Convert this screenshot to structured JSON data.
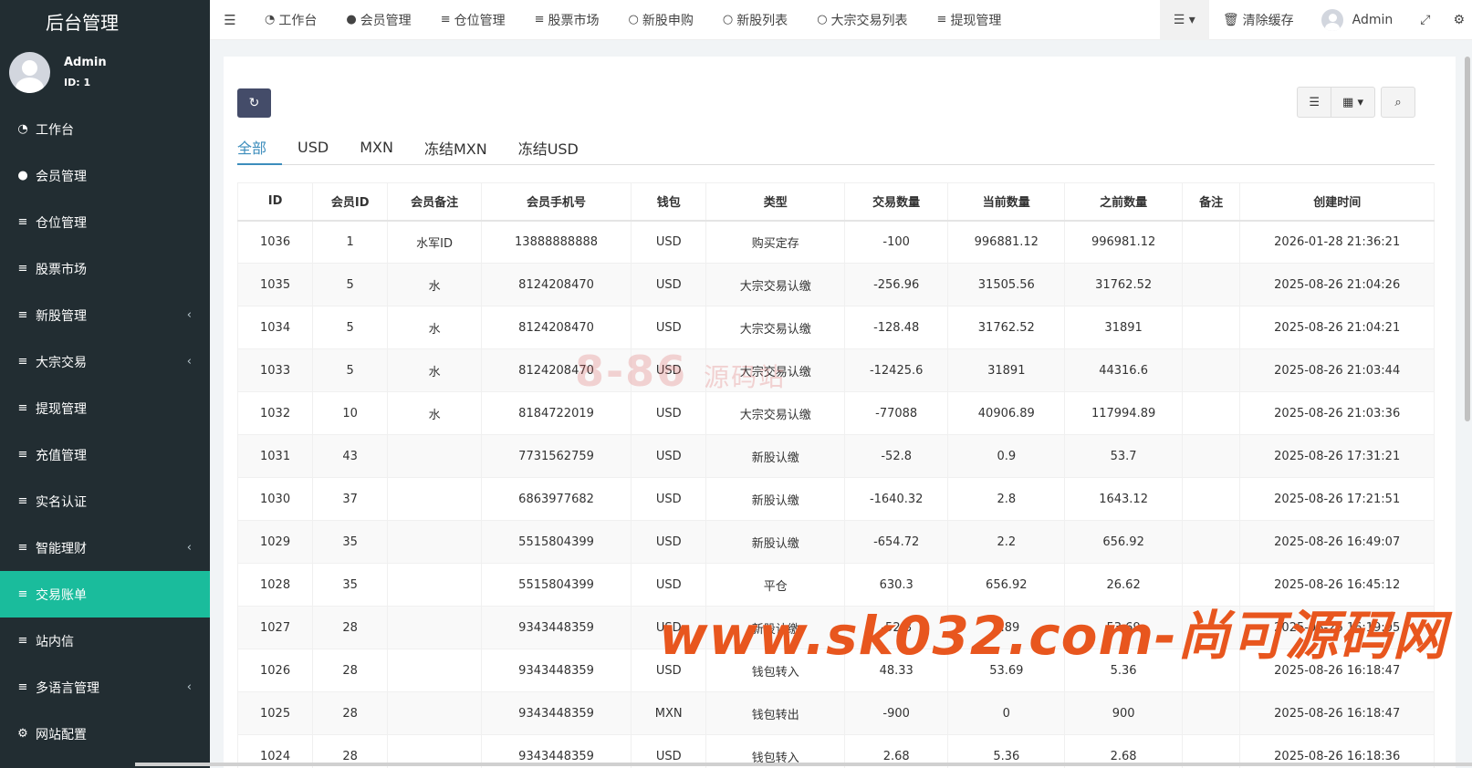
{
  "brand": "后台管理",
  "user": {
    "name": "Admin",
    "id": "ID: 1"
  },
  "sidebar": {
    "items": [
      {
        "label": "工作台",
        "icon": "dashboard-icon",
        "glyph": "◔",
        "arrow": false
      },
      {
        "label": "会员管理",
        "icon": "user-circle-icon",
        "glyph": "●",
        "arrow": false
      },
      {
        "label": "仓位管理",
        "icon": "bars-icon",
        "glyph": "≡",
        "arrow": false
      },
      {
        "label": "股票市场",
        "icon": "bars-icon",
        "glyph": "≡",
        "arrow": false
      },
      {
        "label": "新股管理",
        "icon": "bars-icon",
        "glyph": "≡",
        "arrow": true
      },
      {
        "label": "大宗交易",
        "icon": "bars-icon",
        "glyph": "≡",
        "arrow": true
      },
      {
        "label": "提现管理",
        "icon": "bars-icon",
        "glyph": "≡",
        "arrow": false
      },
      {
        "label": "充值管理",
        "icon": "bars-icon",
        "glyph": "≡",
        "arrow": false
      },
      {
        "label": "实名认证",
        "icon": "bars-icon",
        "glyph": "≡",
        "arrow": false
      },
      {
        "label": "智能理财",
        "icon": "bars-icon",
        "glyph": "≡",
        "arrow": true
      },
      {
        "label": "交易账单",
        "icon": "bars-icon",
        "glyph": "≡",
        "arrow": false,
        "active": true
      },
      {
        "label": "站内信",
        "icon": "bars-icon",
        "glyph": "≡",
        "arrow": false
      },
      {
        "label": "多语言管理",
        "icon": "bars-icon",
        "glyph": "≡",
        "arrow": true
      },
      {
        "label": "网站配置",
        "icon": "gear-icon",
        "glyph": "⚙",
        "arrow": false
      }
    ]
  },
  "topnav": {
    "items": [
      {
        "label": "工作台",
        "glyph": "◔"
      },
      {
        "label": "会员管理",
        "glyph": "●"
      },
      {
        "label": "仓位管理",
        "glyph": "≡"
      },
      {
        "label": "股票市场",
        "glyph": "≡"
      },
      {
        "label": "新股申购",
        "glyph": "○"
      },
      {
        "label": "新股列表",
        "glyph": "○"
      },
      {
        "label": "大宗交易列表",
        "glyph": "○"
      },
      {
        "label": "提现管理",
        "glyph": "≡"
      }
    ],
    "clear_cache": "清除缓存",
    "admin": "Admin"
  },
  "tabs": [
    "全部",
    "USD",
    "MXN",
    "冻结MXN",
    "冻结USD"
  ],
  "table": {
    "headers": [
      "ID",
      "会员ID",
      "会员备注",
      "会员手机号",
      "钱包",
      "类型",
      "交易数量",
      "当前数量",
      "之前数量",
      "备注",
      "创建时间"
    ],
    "rows": [
      [
        "1036",
        "1",
        "水军ID",
        "13888888888",
        "USD",
        "购买定存",
        "-100",
        "996881.12",
        "996981.12",
        "",
        "2026-01-28 21:36:21"
      ],
      [
        "1035",
        "5",
        "水",
        "8124208470",
        "USD",
        "大宗交易认缴",
        "-256.96",
        "31505.56",
        "31762.52",
        "",
        "2025-08-26 21:04:26"
      ],
      [
        "1034",
        "5",
        "水",
        "8124208470",
        "USD",
        "大宗交易认缴",
        "-128.48",
        "31762.52",
        "31891",
        "",
        "2025-08-26 21:04:21"
      ],
      [
        "1033",
        "5",
        "水",
        "8124208470",
        "USD",
        "大宗交易认缴",
        "-12425.6",
        "31891",
        "44316.6",
        "",
        "2025-08-26 21:03:44"
      ],
      [
        "1032",
        "10",
        "水",
        "8184722019",
        "USD",
        "大宗交易认缴",
        "-77088",
        "40906.89",
        "117994.89",
        "",
        "2025-08-26 21:03:36"
      ],
      [
        "1031",
        "43",
        "",
        "7731562759",
        "USD",
        "新股认缴",
        "-52.8",
        "0.9",
        "53.7",
        "",
        "2025-08-26 17:31:21"
      ],
      [
        "1030",
        "37",
        "",
        "6863977682",
        "USD",
        "新股认缴",
        "-1640.32",
        "2.8",
        "1643.12",
        "",
        "2025-08-26 17:21:51"
      ],
      [
        "1029",
        "35",
        "",
        "5515804399",
        "USD",
        "新股认缴",
        "-654.72",
        "2.2",
        "656.92",
        "",
        "2025-08-26 16:49:07"
      ],
      [
        "1028",
        "35",
        "",
        "5515804399",
        "USD",
        "平仓",
        "630.3",
        "656.92",
        "26.62",
        "",
        "2025-08-26 16:45:12"
      ],
      [
        "1027",
        "28",
        "",
        "9343448359",
        "USD",
        "新股认缴",
        "-52.8",
        "0.89",
        "53.69",
        "",
        "2025-08-26 16:19:05"
      ],
      [
        "1026",
        "28",
        "",
        "9343448359",
        "USD",
        "钱包转入",
        "48.33",
        "53.69",
        "5.36",
        "",
        "2025-08-26 16:18:47"
      ],
      [
        "1025",
        "28",
        "",
        "9343448359",
        "MXN",
        "钱包转出",
        "-900",
        "0",
        "900",
        "",
        "2025-08-26 16:18:47"
      ],
      [
        "1024",
        "28",
        "",
        "9343448359",
        "USD",
        "钱包转入",
        "2.68",
        "5.36",
        "2.68",
        "",
        "2025-08-26 16:18:36"
      ]
    ]
  },
  "watermarks": {
    "logo_text": "8-86",
    "logo_cn": "源码站",
    "site": "www.sk032.com-尚可源码网"
  },
  "colors": {
    "sidebar_bg": "#222d32",
    "active": "#1abc9c",
    "primary_btn": "#444c69",
    "tab_active": "#3c8dbc",
    "watermark": "#e8561e"
  }
}
